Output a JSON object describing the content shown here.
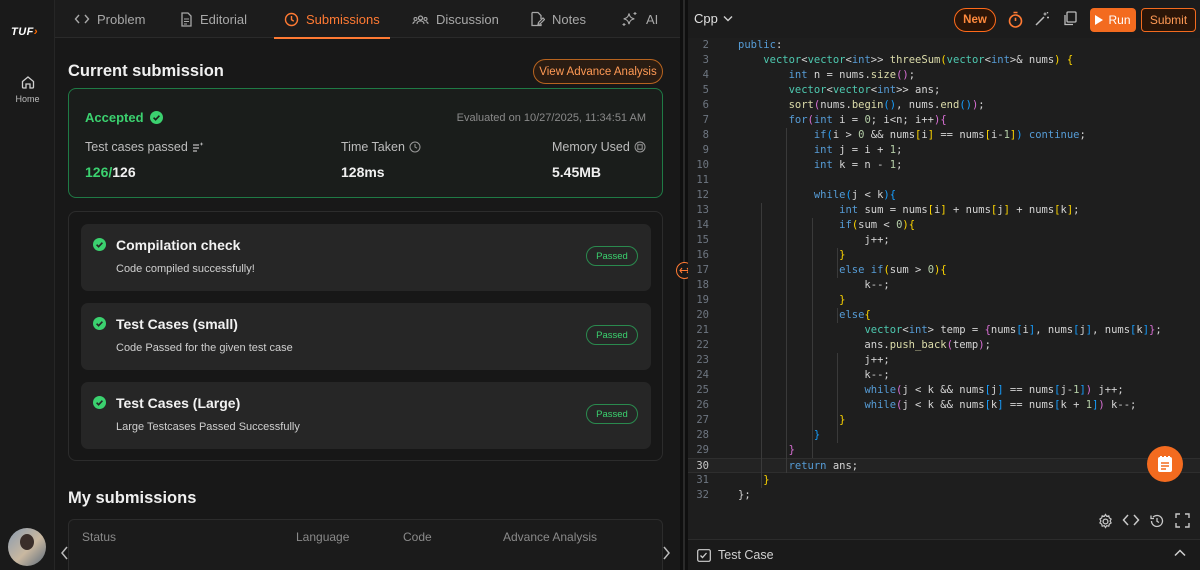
{
  "rail": {
    "logo": "TUF",
    "logo_accent": "›",
    "home_label": "Home"
  },
  "tabs": [
    {
      "label": "Problem",
      "icon": "code-icon"
    },
    {
      "label": "Editorial",
      "icon": "document-icon"
    },
    {
      "label": "Submissions",
      "icon": "clock-icon",
      "active": true
    },
    {
      "label": "Discussion",
      "icon": "users-icon"
    },
    {
      "label": "Notes",
      "icon": "note-edit-icon"
    },
    {
      "label": "AI",
      "icon": "sparkle-icon"
    }
  ],
  "current": {
    "title": "Current submission",
    "advance_button": "View Advance Analysis",
    "status": "Accepted",
    "evaluated": "Evaluated on 10/27/2025, 11:34:51 AM",
    "tests_label": "Test cases passed",
    "tests_passed": "126/",
    "tests_total": "126",
    "time_label": "Time Taken",
    "time_value": "128ms",
    "memory_label": "Memory Used",
    "memory_value": "5.45MB"
  },
  "checks": [
    {
      "title": "Compilation check",
      "subtitle": "Code compiled successfully!",
      "badge": "Passed"
    },
    {
      "title": "Test Cases (small)",
      "subtitle": "Code Passed for the given test case",
      "badge": "Passed"
    },
    {
      "title": "Test Cases (Large)",
      "subtitle": "Large Testcases Passed Successfully",
      "badge": "Passed"
    }
  ],
  "my_submissions": {
    "title": "My submissions",
    "columns": [
      "Status",
      "Language",
      "Code",
      "Advance Analysis"
    ]
  },
  "editor": {
    "language": "Cpp",
    "new_label": "New",
    "run_label": "Run",
    "submit_label": "Submit",
    "current_line": 30,
    "lines": [
      {
        "n": 2,
        "html": "<span class='kw'>public</span>:"
      },
      {
        "n": 3,
        "html": "    <span class='ty'>vector</span>&lt;<span class='ty'>vector</span>&lt;<span class='kw'>int</span>&gt;&gt; <span class='fn'>threeSum</span><span class='br1'>(</span><span class='ty'>vector</span>&lt;<span class='kw'>int</span>&gt;&amp; nums<span class='br1'>)</span> <span class='br1'>{</span>"
      },
      {
        "n": 4,
        "html": "        <span class='kw'>int</span> n = nums.<span class='fn'>size</span><span class='br2'>()</span>;"
      },
      {
        "n": 5,
        "html": "        <span class='ty'>vector</span>&lt;<span class='ty'>vector</span>&lt;<span class='kw'>int</span>&gt;&gt; ans;"
      },
      {
        "n": 6,
        "html": "        <span class='fn'>sort</span><span class='br2'>(</span>nums.<span class='fn'>begin</span><span class='br3'>()</span>, nums.<span class='fn'>end</span><span class='br3'>()</span><span class='br2'>)</span>;"
      },
      {
        "n": 7,
        "html": "        <span class='kw'>for</span><span class='br2'>(</span><span class='kw'>int</span> i = <span class='nm'>0</span>; i&lt;n; i++<span class='br2'>){</span>"
      },
      {
        "n": 8,
        "html": "            <span class='kw'>if</span><span class='br3'>(</span>i &gt; <span class='nm'>0</span> &amp;&amp; nums<span class='br1'>[</span>i<span class='br1'>]</span> == nums<span class='br1'>[</span>i-<span class='nm'>1</span><span class='br1'>]</span><span class='br3'>)</span> <span class='kw'>continue</span>;"
      },
      {
        "n": 9,
        "html": "            <span class='kw'>int</span> j = i + <span class='nm'>1</span>;"
      },
      {
        "n": 10,
        "html": "            <span class='kw'>int</span> k = n - <span class='nm'>1</span>;"
      },
      {
        "n": 11,
        "html": ""
      },
      {
        "n": 12,
        "html": "            <span class='kw'>while</span><span class='br3'>(</span>j &lt; k<span class='br3'>){</span>"
      },
      {
        "n": 13,
        "html": "                <span class='kw'>int</span> sum = nums<span class='br1'>[</span>i<span class='br1'>]</span> + nums<span class='br1'>[</span>j<span class='br1'>]</span> + nums<span class='br1'>[</span>k<span class='br1'>]</span>;"
      },
      {
        "n": 14,
        "html": "                <span class='kw'>if</span><span class='br1'>(</span>sum &lt; <span class='nm'>0</span><span class='br1'>){</span>"
      },
      {
        "n": 15,
        "html": "                    j++;"
      },
      {
        "n": 16,
        "html": "                <span class='br1'>}</span>"
      },
      {
        "n": 17,
        "html": "                <span class='kw'>else</span> <span class='kw'>if</span><span class='br1'>(</span>sum &gt; <span class='nm'>0</span><span class='br1'>){</span>"
      },
      {
        "n": 18,
        "html": "                    k--;"
      },
      {
        "n": 19,
        "html": "                <span class='br1'>}</span>"
      },
      {
        "n": 20,
        "html": "                <span class='kw'>else</span><span class='br1'>{</span>"
      },
      {
        "n": 21,
        "html": "                    <span class='ty'>vector</span>&lt;<span class='kw'>int</span>&gt; temp = <span class='br2'>{</span>nums<span class='br3'>[</span>i<span class='br3'>]</span>, nums<span class='br3'>[</span>j<span class='br3'>]</span>, nums<span class='br3'>[</span>k<span class='br3'>]</span><span class='br2'>}</span>;"
      },
      {
        "n": 22,
        "html": "                    ans.<span class='fn'>push_back</span><span class='br2'>(</span>temp<span class='br2'>)</span>;"
      },
      {
        "n": 23,
        "html": "                    j++;"
      },
      {
        "n": 24,
        "html": "                    k--;"
      },
      {
        "n": 25,
        "html": "                    <span class='kw'>while</span><span class='br2'>(</span>j &lt; k &amp;&amp; nums<span class='br3'>[</span>j<span class='br3'>]</span> == nums<span class='br3'>[</span>j-<span class='nm'>1</span><span class='br3'>]</span><span class='br2'>)</span> j++;"
      },
      {
        "n": 26,
        "html": "                    <span class='kw'>while</span><span class='br2'>(</span>j &lt; k &amp;&amp; nums<span class='br3'>[</span>k<span class='br3'>]</span> == nums<span class='br3'>[</span>k + <span class='nm'>1</span><span class='br3'>]</span><span class='br2'>)</span> k--;"
      },
      {
        "n": 27,
        "html": "                <span class='br1'>}</span>"
      },
      {
        "n": 28,
        "html": "            <span class='br3'>}</span>"
      },
      {
        "n": 29,
        "html": "        <span class='br2'>}</span>"
      },
      {
        "n": 30,
        "html": "        <span class='kw'>return</span> ans;"
      },
      {
        "n": 31,
        "html": "    <span class='br1'>}</span>"
      },
      {
        "n": 32,
        "html": "};"
      }
    ]
  },
  "bottom": {
    "test_case_label": "Test Case"
  },
  "colors": {
    "accent": "#f36b1f",
    "success": "#3bd16f"
  }
}
